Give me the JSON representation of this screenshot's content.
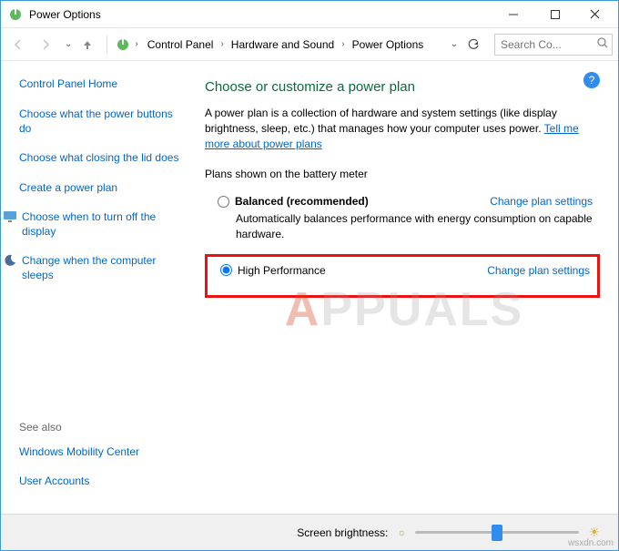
{
  "window": {
    "title": "Power Options"
  },
  "breadcrumbs": {
    "items": [
      "Control Panel",
      "Hardware and Sound",
      "Power Options"
    ]
  },
  "search": {
    "placeholder": "Search Co..."
  },
  "sidebar": {
    "home": "Control Panel Home",
    "links": [
      "Choose what the power buttons do",
      "Choose what closing the lid does",
      "Create a power plan",
      "Choose when to turn off the display",
      "Change when the computer sleeps"
    ],
    "seealso_label": "See also",
    "seealso": [
      "Windows Mobility Center",
      "User Accounts"
    ]
  },
  "main": {
    "heading": "Choose or customize a power plan",
    "description": "A power plan is a collection of hardware and system settings (like display brightness, sleep, etc.) that manages how your computer uses power. ",
    "description_link": "Tell me more about power plans",
    "section_label": "Plans shown on the battery meter",
    "plans": [
      {
        "name": "Balanced (recommended)",
        "desc": "Automatically balances performance with energy consumption on capable hardware.",
        "link": "Change plan settings",
        "selected": false
      },
      {
        "name": "High Performance",
        "desc": "",
        "link": "Change plan settings",
        "selected": true
      }
    ]
  },
  "footer": {
    "label": "Screen brightness:"
  },
  "watermark": {
    "a": "A",
    "rest": "PPUALS"
  },
  "credit": "wsxdn.com"
}
